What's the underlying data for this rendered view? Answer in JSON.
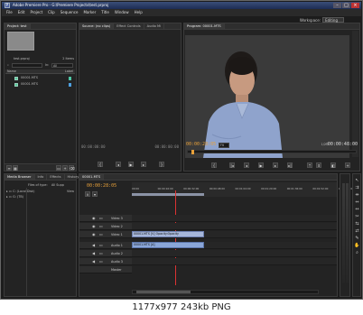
{
  "window": {
    "title": "Adobe Premiere Pro - G:\\Premiere Projects\\test.prproj"
  },
  "menu": [
    "File",
    "Edit",
    "Project",
    "Clip",
    "Sequence",
    "Marker",
    "Title",
    "Window",
    "Help"
  ],
  "workspace": {
    "label": "Workspace:",
    "value": "Editing"
  },
  "project_panel": {
    "tab": "Project: test",
    "filename": "test.prproj",
    "items_count": "2 Items",
    "in_label": "In:",
    "in_value": "All",
    "col_name": "Name",
    "col_label": "Label",
    "items": [
      "00001.MTS",
      "00001.MTS"
    ]
  },
  "media_browser": {
    "tabs": [
      "Media Browser",
      "Info",
      "Effects",
      "History"
    ],
    "files_label": "Files of type:",
    "files_value": "All Supp",
    "view_label": "View",
    "drives": [
      "C: (Local Disk)",
      "G: (TB)"
    ]
  },
  "source_panel": {
    "tabs": [
      "Source: (no clips)",
      "Effect Controls",
      "Audio Mi"
    ],
    "timecodes": [
      "00:00:00:00",
      "00:00:00:00"
    ]
  },
  "program_panel": {
    "tab": "Program: 00001.MTS",
    "current": "00:00:28:05",
    "fit": "Fit",
    "ratio": "1/2",
    "duration": "00:00:48:00"
  },
  "timeline": {
    "tab": "00001.MTS",
    "timecode": "00:00:28:05",
    "ruler": [
      "00:00",
      "00:00:16:00",
      "00:00:32:00",
      "00:00:48:00",
      "00:01:04:00",
      "00:01:20:00",
      "00:01:36:00",
      "00:01:52:00",
      "00:02:08:00"
    ],
    "video_tracks": [
      "Video 3",
      "Video 2",
      "Video 1"
    ],
    "audio_tracks": [
      "Audio 1",
      "Audio 2",
      "Audio 3"
    ],
    "master": "Master",
    "video_clip": "00001.MTS [V] Opacity:Opacity",
    "audio_clip": "00001.MTS [A]"
  },
  "caption": "1177x977 243kb PNG"
}
